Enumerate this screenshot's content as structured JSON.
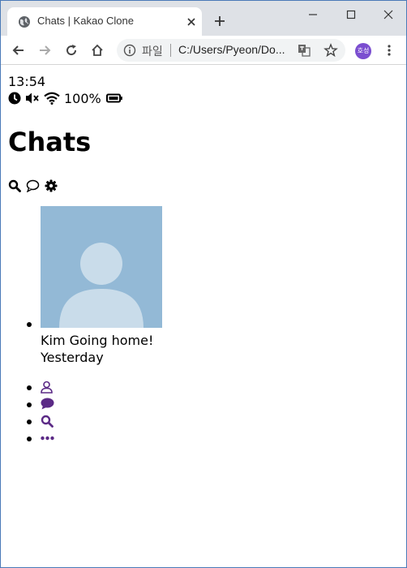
{
  "browser": {
    "tab_title": "Chats | Kakao Clone",
    "url_scheme_label": "파일",
    "url": "C:/Users/Pyeon/Do...",
    "profile_initials": "호성"
  },
  "status_bar": {
    "time": "13:54",
    "battery": "100%",
    "icons": [
      "clock-icon",
      "mute-icon",
      "wifi-icon",
      "battery-icon"
    ]
  },
  "header": {
    "title": "Chats",
    "actions": [
      "search-icon",
      "chat-bubble-icon",
      "gear-icon"
    ]
  },
  "chats": [
    {
      "name_preview": "Kim Going home!",
      "time": "Yesterday",
      "avatar": "default-avatar"
    }
  ],
  "nav": {
    "items": [
      "user-icon",
      "chat-icon",
      "search-icon",
      "more-icon"
    ],
    "color": "#5b2a86"
  }
}
